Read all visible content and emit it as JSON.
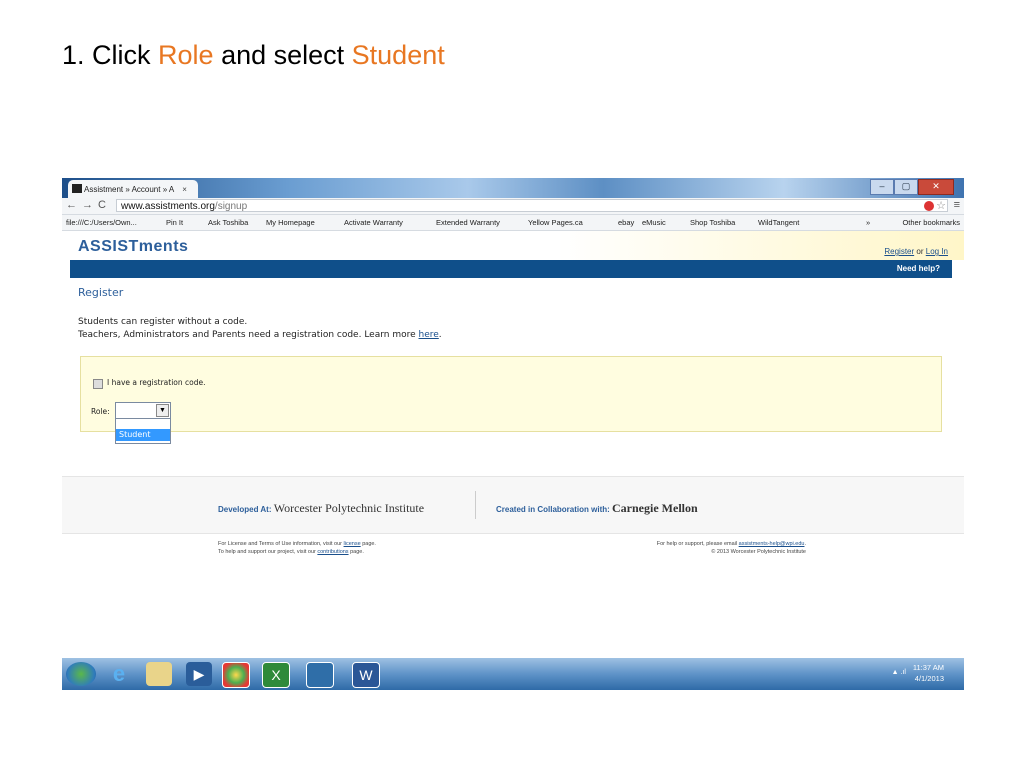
{
  "slide": {
    "title_parts": [
      "1. Click ",
      "Role",
      " and select ",
      "Student"
    ]
  },
  "browser": {
    "tab_title": "Assistment » Account » A",
    "tab_close": "×",
    "url_domain": "www.assistments.org",
    "url_path": "/signup",
    "window_buttons": [
      "–",
      "▢",
      "✕"
    ],
    "bookmarks": [
      "file:///C:/Users/Own...",
      "Pin It",
      "Ask Toshiba",
      "My Homepage",
      "Activate Warranty",
      "Extended Warranty",
      "Yellow Pages.ca",
      "ebay",
      "eMusic",
      "Shop Toshiba",
      "WildTangent"
    ],
    "bookmarks_more": "»",
    "other_bookmarks": "Other bookmarks"
  },
  "site": {
    "logo": "ASSISTments",
    "register_link": "Register",
    "or": "or",
    "login_link": "Log In",
    "need_help": "Need help?",
    "page_title": "Register",
    "line1": "Students can register without a code.",
    "line2_prefix": "Teachers, Administrators and Parents need a registration code. Learn more ",
    "line2_link": "here",
    "line2_suffix": ".",
    "checkbox_label": "I have a registration code.",
    "role_label": "Role:",
    "role_value": "",
    "role_options": [
      "",
      "Student"
    ],
    "role_highlighted": "Student"
  },
  "footer": {
    "developed_label": "Developed At:",
    "developed_inst": "Worcester Polytechnic Institute",
    "collab_label": "Created in Collaboration with:",
    "collab_inst": "Carnegie Mellon",
    "left_line1_pre": "For License and Terms of Use information, visit our ",
    "left_line1_link": "license",
    "left_line1_post": " page.",
    "left_line2_pre": "To help and support our project, visit our ",
    "left_line2_link": "contributions",
    "left_line2_post": " page.",
    "right_line1_pre": "For help or support, please email ",
    "right_line1_link": "assistments-help@wpi.edu",
    "right_line1_post": ".",
    "right_line2": "© 2013 Worcester Polytechnic Institute"
  },
  "taskbar": {
    "time": "11:37 AM",
    "date": "4/1/2013"
  },
  "colors": {
    "highlight": "#e87722",
    "brand_blue": "#0f4f8a",
    "selection": "#3399ff"
  }
}
